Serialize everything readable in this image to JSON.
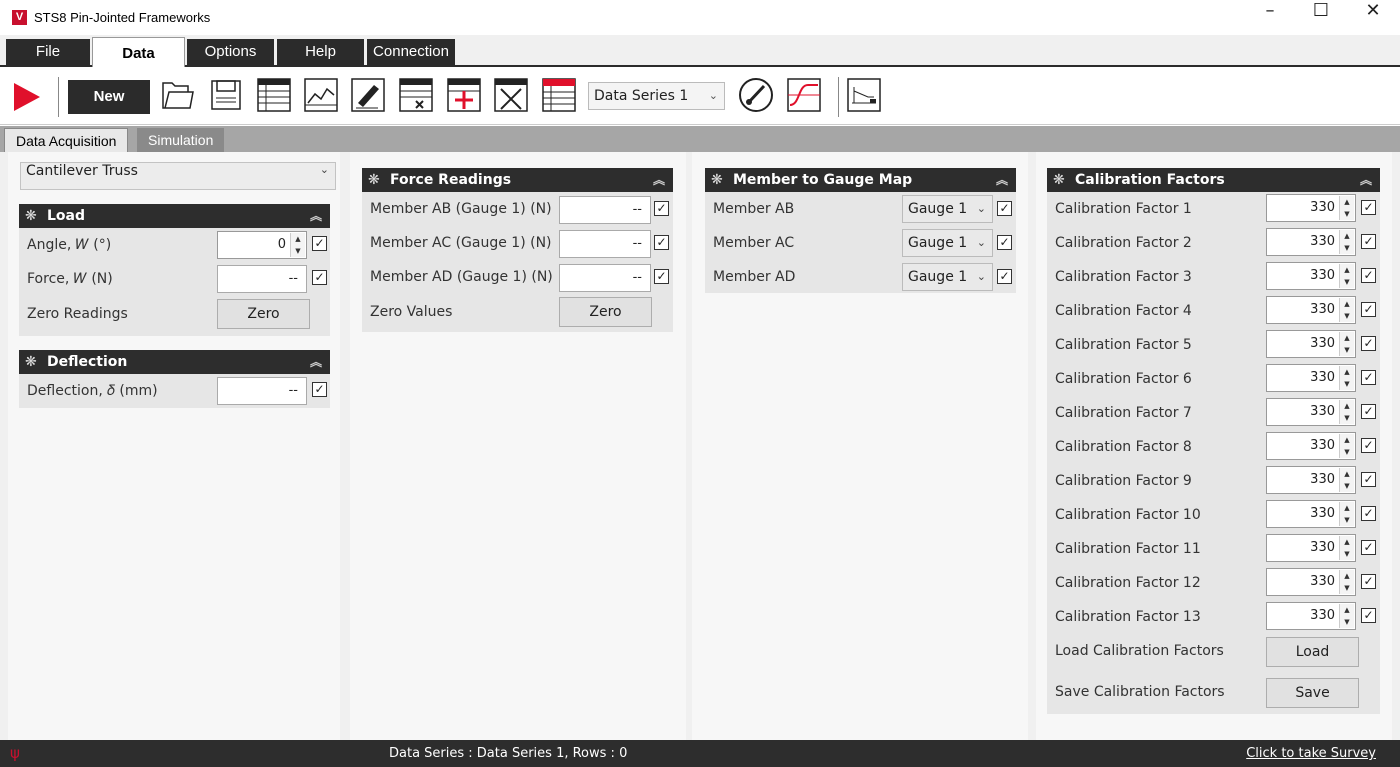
{
  "window": {
    "title": "STS8 Pin-Jointed Frameworks",
    "logo": "V",
    "minimize": "–",
    "maximize": "☐",
    "close": "✕"
  },
  "menu_tabs": [
    "File",
    "Data",
    "Options",
    "Help",
    "Connection"
  ],
  "toolbar": {
    "new_label": "New",
    "data_series": "Data Series 1",
    "icons": [
      "play-icon",
      "open-folder-icon",
      "save-icon",
      "table-icon",
      "line-graph-icon",
      "edit-icon",
      "delete-row-icon",
      "add-row-icon",
      "clear-table-icon",
      "table-header-icon",
      "gauge-icon",
      "curve-icon",
      "apparatus-icon"
    ]
  },
  "sub_tabs": [
    "Data Acquisition",
    "Simulation"
  ],
  "experiment": "Cantilever Truss",
  "load_panel": {
    "title": "Load",
    "angle_label": "Angle, 𝑊 (°)",
    "angle_value": "0",
    "force_label": "Force, 𝑊 (N)",
    "force_value": "--",
    "zero_label": "Zero Readings",
    "zero_button": "Zero"
  },
  "deflection_panel": {
    "title": "Deflection",
    "label": "Deflection, 𝛿 (mm)",
    "value": "--"
  },
  "force_panel": {
    "title": "Force Readings",
    "rows": [
      {
        "label": "Member AB (Gauge 1) (N)",
        "value": "--"
      },
      {
        "label": "Member AC (Gauge 1) (N)",
        "value": "--"
      },
      {
        "label": "Member AD (Gauge 1) (N)",
        "value": "--"
      }
    ],
    "zero_label": "Zero Values",
    "zero_button": "Zero"
  },
  "gauge_map_panel": {
    "title": "Member to Gauge Map",
    "rows": [
      {
        "label": "Member AB",
        "gauge": "Gauge 1"
      },
      {
        "label": "Member AC",
        "gauge": "Gauge 1"
      },
      {
        "label": "Member AD",
        "gauge": "Gauge 1"
      }
    ]
  },
  "calibration_panel": {
    "title": "Calibration Factors",
    "rows": [
      {
        "label": "Calibration Factor 1",
        "value": "330"
      },
      {
        "label": "Calibration Factor 2",
        "value": "330"
      },
      {
        "label": "Calibration Factor 3",
        "value": "330"
      },
      {
        "label": "Calibration Factor 4",
        "value": "330"
      },
      {
        "label": "Calibration Factor 5",
        "value": "330"
      },
      {
        "label": "Calibration Factor 6",
        "value": "330"
      },
      {
        "label": "Calibration Factor 7",
        "value": "330"
      },
      {
        "label": "Calibration Factor 8",
        "value": "330"
      },
      {
        "label": "Calibration Factor 9",
        "value": "330"
      },
      {
        "label": "Calibration Factor 10",
        "value": "330"
      },
      {
        "label": "Calibration Factor 11",
        "value": "330"
      },
      {
        "label": "Calibration Factor 12",
        "value": "330"
      },
      {
        "label": "Calibration Factor 13",
        "value": "330"
      }
    ],
    "load_label": "Load Calibration Factors",
    "load_button": "Load",
    "save_label": "Save Calibration Factors",
    "save_button": "Save"
  },
  "status": {
    "text": "Data Series : Data Series 1,  Rows : 0",
    "survey": "Click to take Survey"
  },
  "colors": {
    "accent": "#e0102b",
    "header": "#2d2d2d",
    "panel_bg": "#e6e6e6"
  }
}
